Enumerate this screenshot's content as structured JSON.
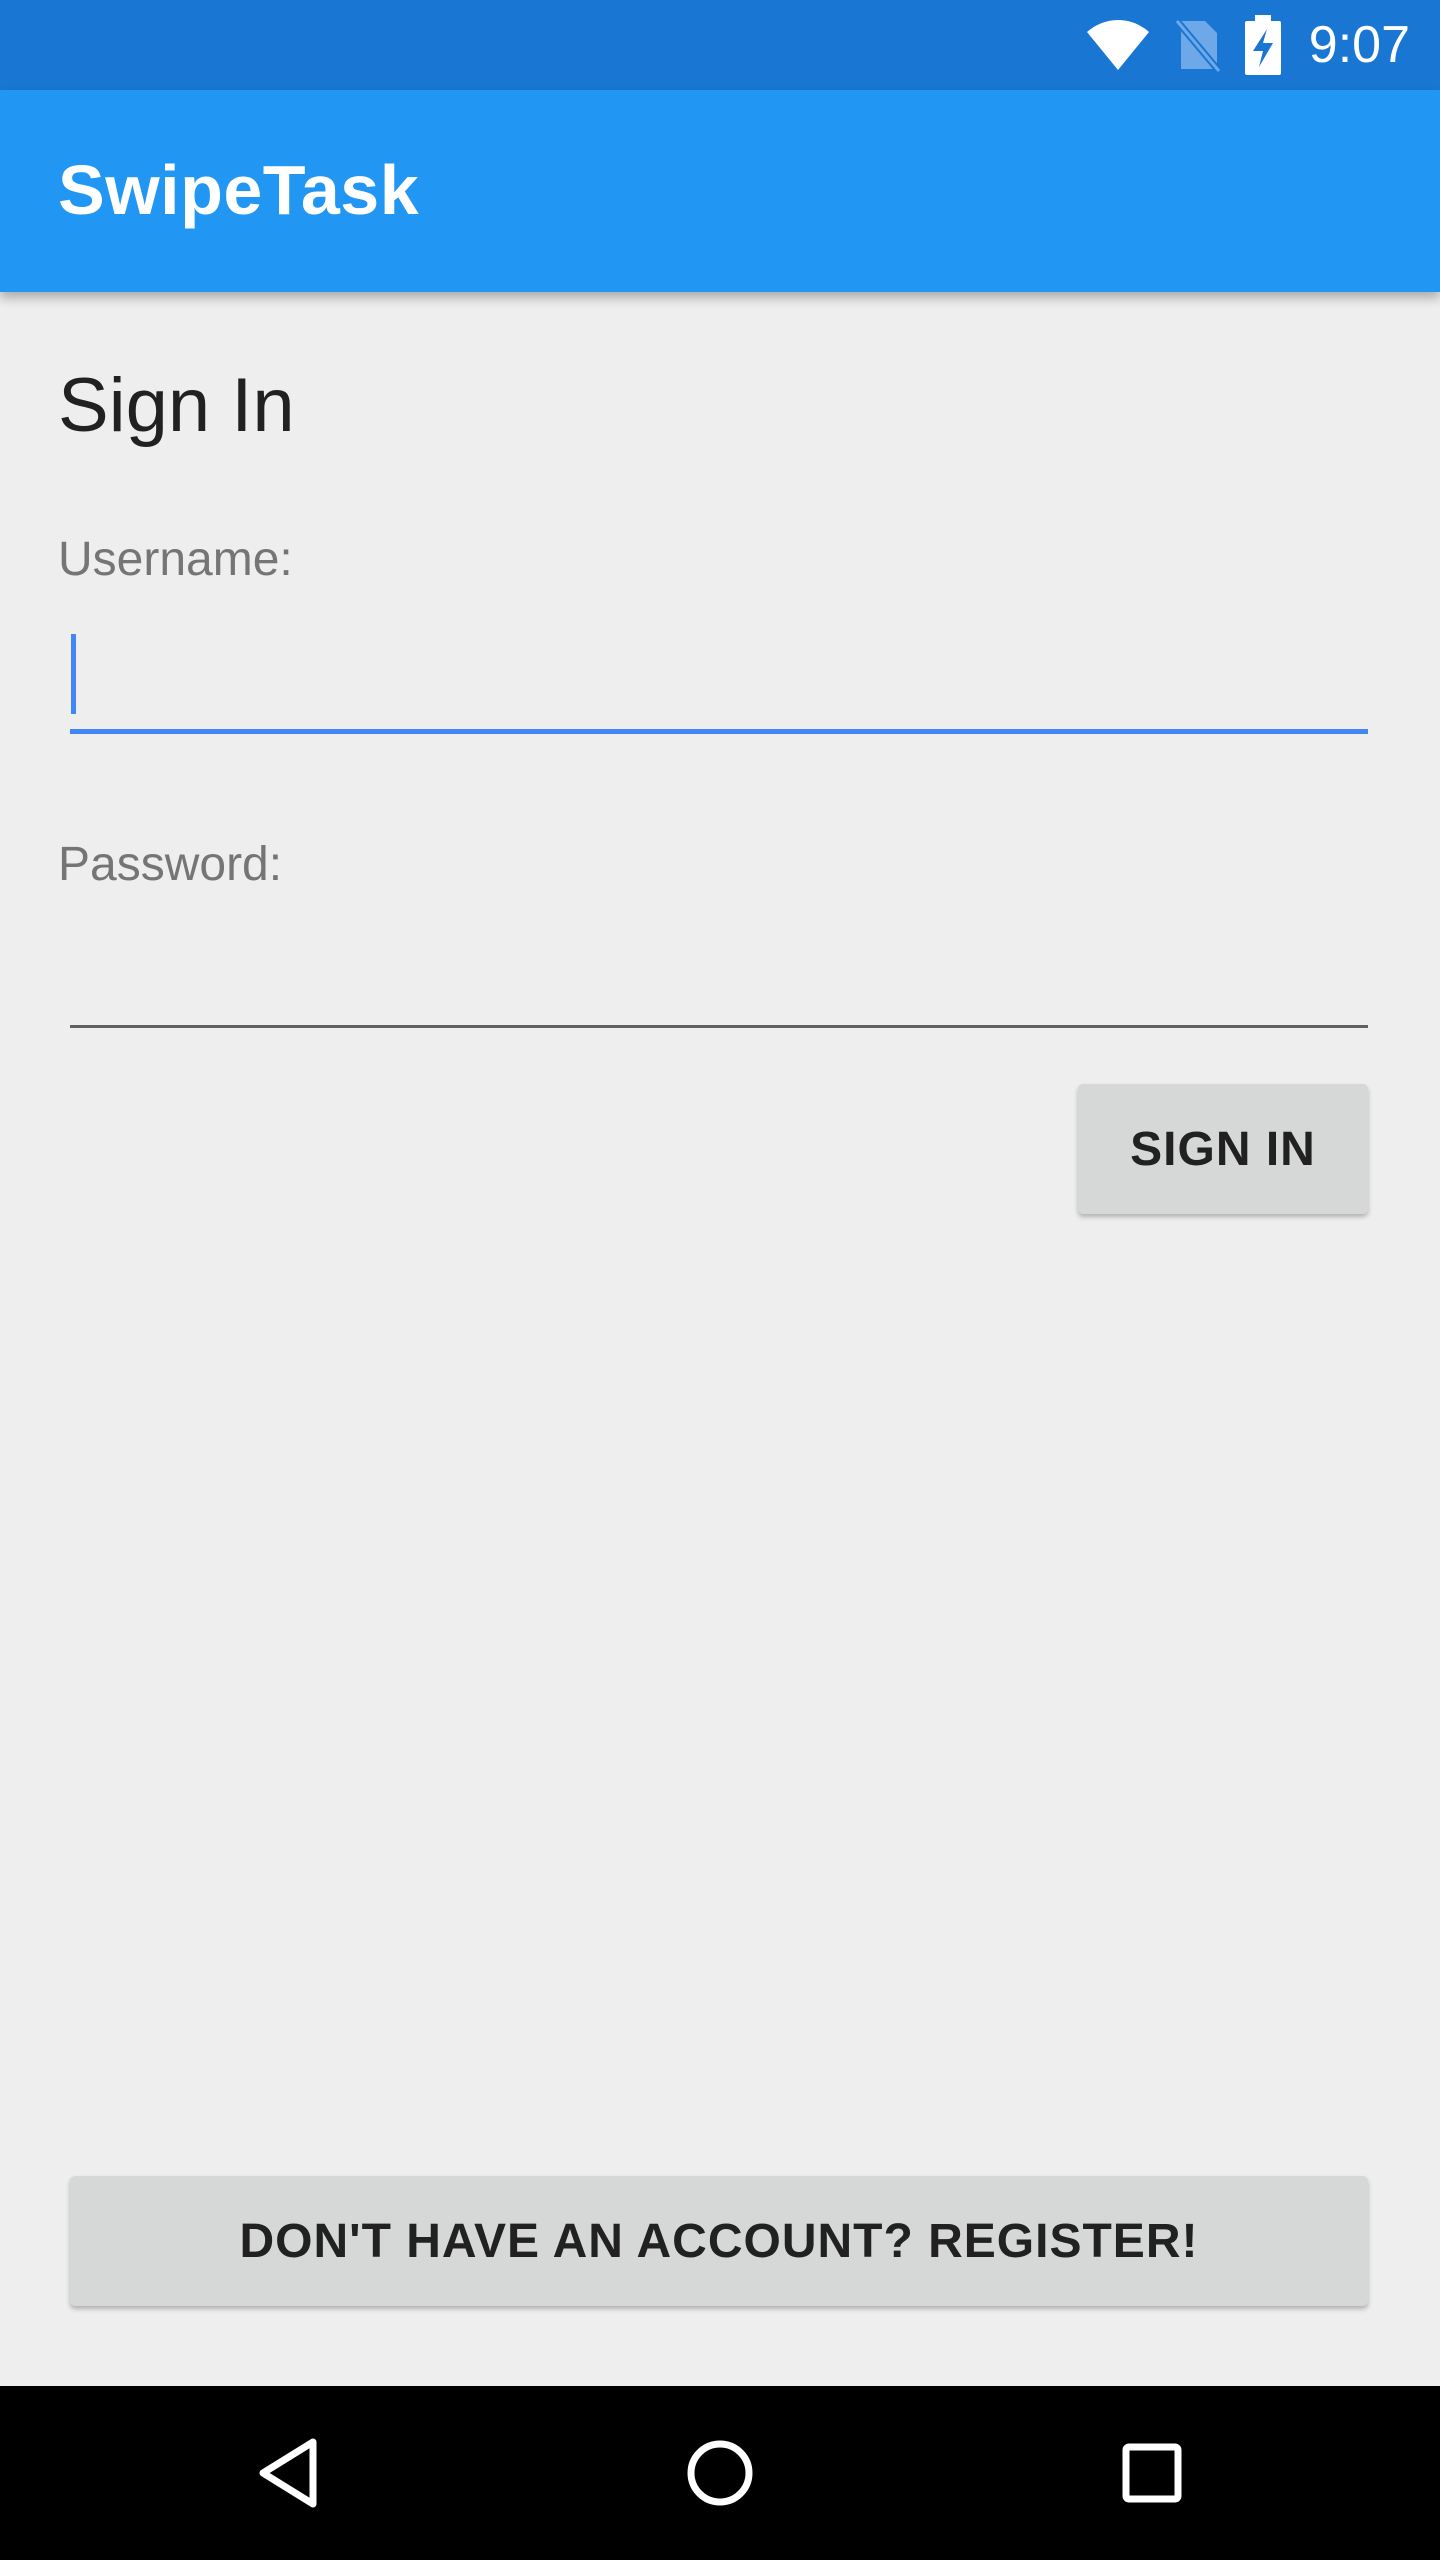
{
  "status_bar": {
    "time": "9:07",
    "icons": [
      "wifi-icon",
      "no-sim-icon",
      "battery-charging-icon"
    ],
    "color": "#1976d2"
  },
  "app_bar": {
    "title": "SwipeTask",
    "color": "#2196f3"
  },
  "sign_in": {
    "heading": "Sign In",
    "username_label": "Username:",
    "username_value": "",
    "password_label": "Password:",
    "password_value": "",
    "submit_label": "SIGN IN"
  },
  "register": {
    "label": "DON'T HAVE AN ACCOUNT? REGISTER!"
  },
  "nav_bar": {
    "buttons": [
      "back-icon",
      "home-icon",
      "recents-icon"
    ]
  },
  "colors": {
    "accent": "#4285f4",
    "background": "#eeeeee",
    "button": "#d6d7d7"
  }
}
